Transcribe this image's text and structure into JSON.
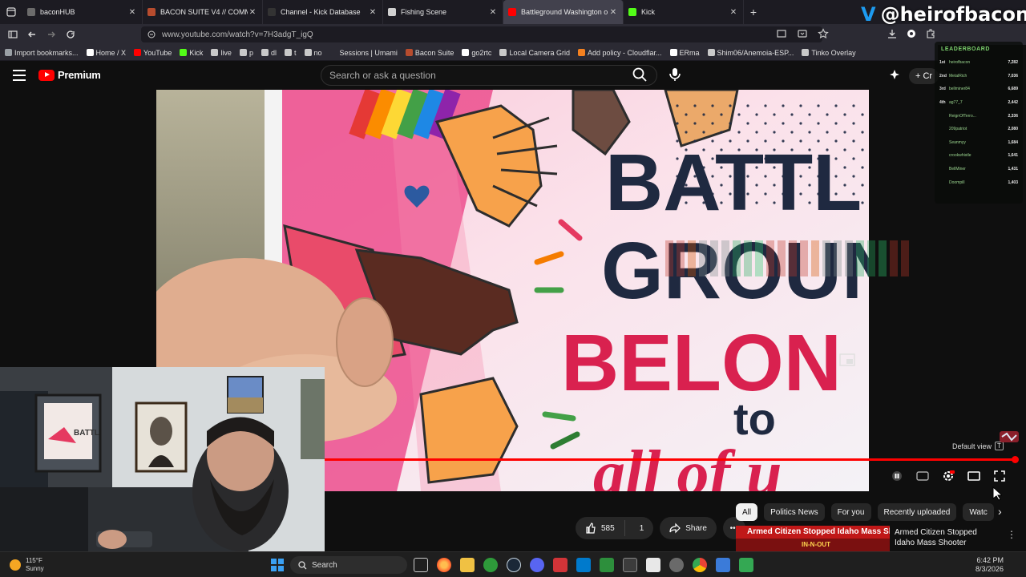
{
  "browser": {
    "tabs": [
      {
        "title": "baconHUB",
        "color": "#6b6b6b",
        "active": false
      },
      {
        "title": "BACON SUITE V4 // COMMAND",
        "color": "#b74c2e",
        "active": false
      },
      {
        "title": "Channel - Kick Database",
        "color": "#333333",
        "active": false
      },
      {
        "title": "Fishing Scene",
        "color": "#d0d0d0",
        "active": false
      },
      {
        "title": "Battleground Washington o",
        "color": "#ff0000",
        "active": true
      },
      {
        "title": "Kick",
        "color": "#53fc18",
        "active": false
      }
    ],
    "url": "www.youtube.com/watch?v=7H3adgT_igQ",
    "bookmarks": [
      {
        "label": "Import bookmarks...",
        "color": "#9aa0a6"
      },
      {
        "label": "Home / X",
        "color": "#ffffff"
      },
      {
        "label": "YouTube",
        "color": "#ff0000"
      },
      {
        "label": "Kick",
        "color": "#53fc18"
      },
      {
        "label": "live",
        "color": "#c9c9c9"
      },
      {
        "label": "p",
        "color": "#c9c9c9"
      },
      {
        "label": "dl",
        "color": "#c9c9c9"
      },
      {
        "label": "t",
        "color": "#c9c9c9"
      },
      {
        "label": "no",
        "color": "#c9c9c9"
      },
      {
        "label": "Sessions | Umami",
        "color": "#2b2a33"
      },
      {
        "label": "Bacon Suite",
        "color": "#b74c2e"
      },
      {
        "label": "go2rtc",
        "color": "#ffffff"
      },
      {
        "label": "Local Camera Grid",
        "color": "#c9c9c9"
      },
      {
        "label": "Add policy - Cloudflar...",
        "color": "#f48120"
      },
      {
        "label": "ERma",
        "color": "#ffffff"
      },
      {
        "label": "Shim06/Anemoia-ESP...",
        "color": "#c9c9c9"
      },
      {
        "label": "Tinko Overlay",
        "color": "#c9c9c9"
      }
    ]
  },
  "overlay": {
    "handle": "@heirofbacon",
    "leaderboard_title": "LEADERBOARD",
    "leaderboard": [
      {
        "rank": "1st",
        "name": "heirofbacon",
        "points": "7,282"
      },
      {
        "rank": "2nd",
        "name": "MetalRich",
        "points": "7,036"
      },
      {
        "rank": "3rd",
        "name": "bellminer84",
        "points": "6,689"
      },
      {
        "rank": "4th",
        "name": "ag77_7",
        "points": "2,442"
      },
      {
        "rank": "",
        "name": "ReignOfTerro...",
        "points": "2,336"
      },
      {
        "rank": "",
        "name": "209patriot",
        "points": "2,080"
      },
      {
        "rank": "",
        "name": "Seanmyy",
        "points": "1,684"
      },
      {
        "rank": "",
        "name": "crookwhistle",
        "points": "1,641"
      },
      {
        "rank": "",
        "name": "BellMiner",
        "points": "1,431"
      },
      {
        "rank": "",
        "name": "Doompill",
        "points": "1,403"
      }
    ]
  },
  "youtube": {
    "logo_word": "Premium",
    "search_placeholder": "Search or ask a question",
    "create_label": "Cr",
    "video": {
      "sign_lines": [
        "BATTL",
        "GROUN",
        "BELON",
        "to",
        "all of u"
      ],
      "progress": 0.995,
      "default_view_label": "Default view",
      "default_view_key": "T"
    },
    "likes": "585",
    "dislikes": "1",
    "share_label": "Share",
    "chips": [
      "All",
      "Politics News",
      "For you",
      "Recently uploaded",
      "Watc"
    ],
    "recommendation": {
      "thumb_text": "Armed Citizen Stopped Idaho Mass Shooter",
      "thumb_subtext": "IN-N-OUT",
      "title": "Armed Citizen Stopped Idaho Mass Shooter"
    }
  },
  "taskbar": {
    "weather_temp": "115°F",
    "weather_desc": "Sunny",
    "search_label": "Search",
    "time": "6:42 PM",
    "date": "8/3/2026"
  }
}
